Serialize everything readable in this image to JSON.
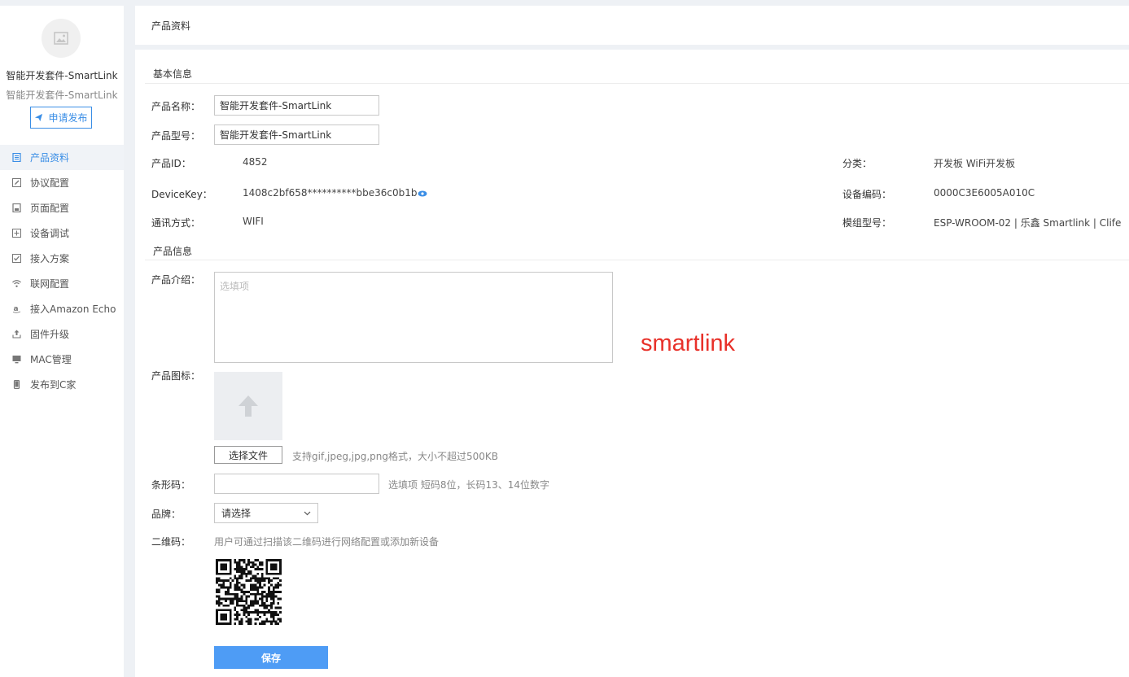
{
  "sidebar": {
    "product_name": "智能开发套件-SmartLink",
    "product_subname": "智能开发套件-SmartLink",
    "publish_label": "申请发布",
    "items": [
      {
        "label": "产品资料",
        "icon": "document-icon",
        "active": true
      },
      {
        "label": "协议配置",
        "icon": "edit-icon",
        "active": false
      },
      {
        "label": "页面配置",
        "icon": "page-icon",
        "active": false
      },
      {
        "label": "设备调试",
        "icon": "debug-icon",
        "active": false
      },
      {
        "label": "接入方案",
        "icon": "checkbox-icon",
        "active": false
      },
      {
        "label": "联网配置",
        "icon": "wifi-icon",
        "active": false
      },
      {
        "label": "接入Amazon Echo",
        "icon": "amazon-icon",
        "active": false
      },
      {
        "label": "固件升级",
        "icon": "upload-icon",
        "active": false
      },
      {
        "label": "MAC管理",
        "icon": "monitor-icon",
        "active": false
      },
      {
        "label": "发布到C家",
        "icon": "phone-icon",
        "active": false
      }
    ]
  },
  "header": {
    "title": "产品资料"
  },
  "basic": {
    "section_title": "基本信息",
    "name_label": "产品名称：",
    "name_value": "智能开发套件-SmartLink",
    "model_label": "产品型号：",
    "model_value": "智能开发套件-SmartLink",
    "id_label": "产品ID：",
    "id_value": "4852",
    "devicekey_label": "DeviceKey：",
    "devicekey_value": "1408c2bf658**********bbe36c0b1b",
    "comm_label": "通讯方式：",
    "comm_value": "WIFI",
    "category_label": "分类：",
    "category_value": "开发板 WiFi开发板",
    "device_code_label": "设备编码：",
    "device_code_value": "0000C3E6005A010C",
    "module_label": "模组型号：",
    "module_value": "ESP-WROOM-02 | 乐鑫 Smartlink | Clife"
  },
  "product": {
    "section_title": "产品信息",
    "intro_label": "产品介绍：",
    "intro_placeholder": "选填项",
    "icon_label": "产品图标：",
    "file_button": "选择文件",
    "file_hint": "支持gif,jpeg,jpg,png格式，大小不超过500KB",
    "barcode_label": "条形码：",
    "barcode_hint": "选填项 短码8位，长码13、14位数字",
    "brand_label": "品牌：",
    "brand_selected": "请选择",
    "qrcode_label": "二维码：",
    "qrcode_hint": "用户可通过扫描该二维码进行网络配置或添加新设备",
    "save_button": "保存"
  },
  "annotation": {
    "text": "smartlink",
    "color": "#e8312a"
  },
  "colors": {
    "accent": "#3a8ee6",
    "save": "#4e9cf5",
    "background": "#eef1f5"
  }
}
